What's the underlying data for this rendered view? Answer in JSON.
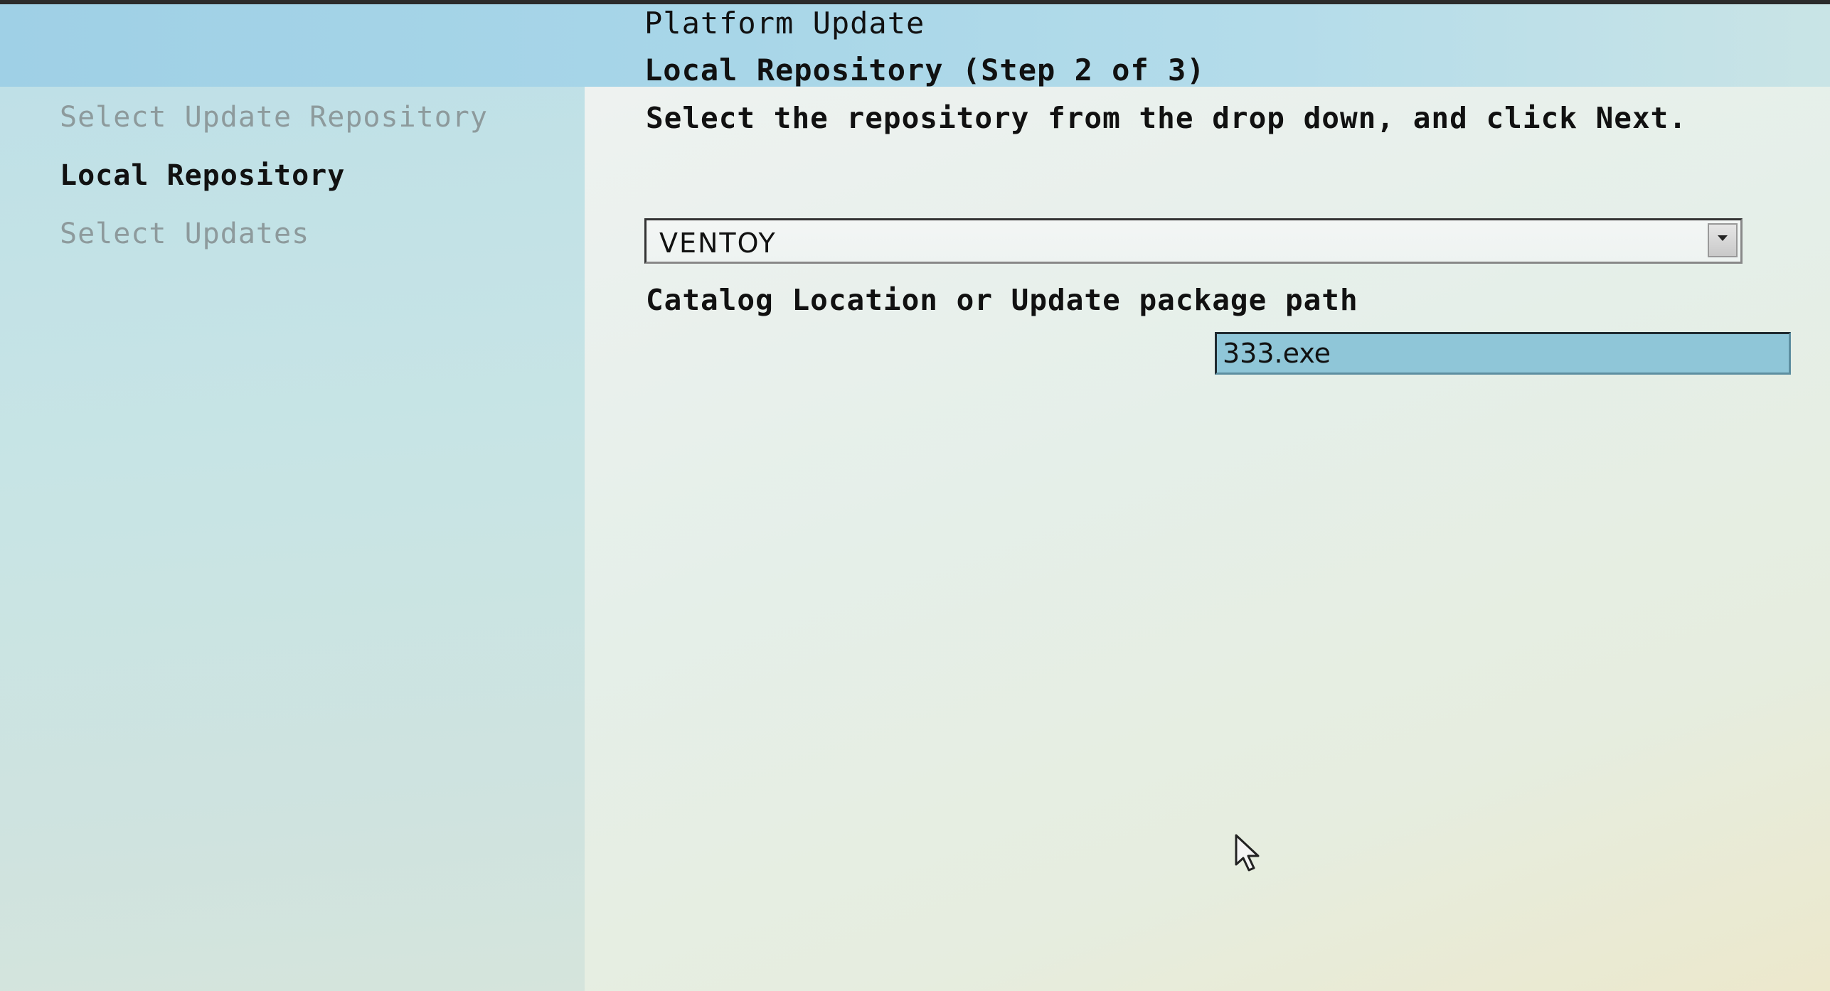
{
  "header": {
    "title": "Platform Update",
    "step": "Local Repository (Step 2 of 3)"
  },
  "sidebar": {
    "items": [
      {
        "label": "Select Update Repository",
        "state": "inactive"
      },
      {
        "label": "Local Repository",
        "state": "active"
      },
      {
        "label": "Select Updates",
        "state": "inactive"
      }
    ]
  },
  "main": {
    "instruction": "Select the repository from the drop down, and click Next.",
    "repository": {
      "selected": "VENTOY"
    },
    "path_field": {
      "label": "Catalog Location or Update package path",
      "value": "333.exe"
    }
  },
  "icons": {
    "dropdown": "chevron-down-icon",
    "pointer": "mouse-pointer-icon"
  },
  "colors": {
    "input_highlight": "#8fc6d8",
    "text": "#111111",
    "inactive_text": "#8d9a9c"
  }
}
